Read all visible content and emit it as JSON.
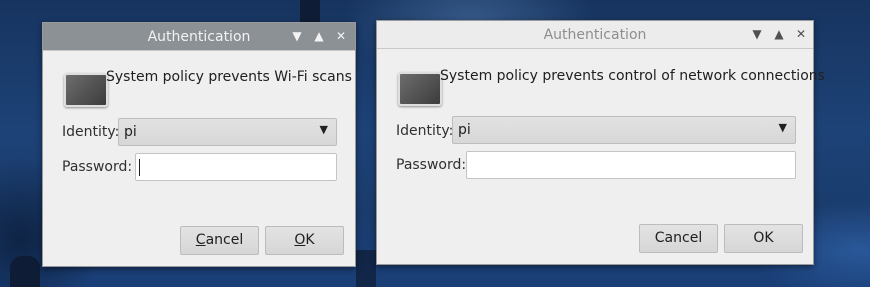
{
  "dialogs": [
    {
      "title": "Authentication",
      "message": "System policy prevents Wi-Fi scans",
      "identity_label": "Identity:",
      "identity_value": "pi",
      "password_label": "Password:",
      "password_value": "",
      "cancel_mnemonic": "C",
      "cancel_rest": "ancel",
      "ok_mnemonic": "O",
      "ok_rest": "K",
      "focused": true
    },
    {
      "title": "Authentication",
      "message": "System policy prevents control of network connections",
      "identity_label": "Identity:",
      "identity_value": "pi",
      "password_label": "Password:",
      "password_value": "",
      "cancel_label": "Cancel",
      "ok_label": "OK",
      "focused": false
    }
  ],
  "titlebar_icons": {
    "minimize": "chevron-down-icon",
    "maximize": "chevron-up-icon",
    "close": "close-icon"
  },
  "colors": {
    "active_titlebar": "#8c9196",
    "inactive_titlebar": "#ececec",
    "dialog_bg": "#efefef"
  }
}
